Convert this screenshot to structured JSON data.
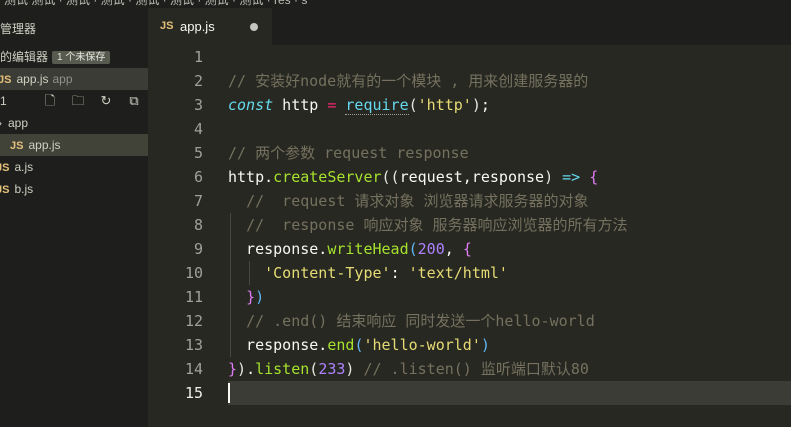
{
  "top_strip_text": "测试 测试 · 测试 · 测试 · 测试 · 测试 · 测试 · 测试 ·  res · s",
  "sidebar": {
    "explorer_title": "管理器",
    "open_editors_label": "的编辑器",
    "unsaved_badge": "1 个未保存",
    "open_file": {
      "tag": "JS",
      "name": "app.js",
      "folder": "app"
    },
    "folder_label": "1",
    "tree": [
      {
        "icon": "folder-chevron-icon",
        "name": "app",
        "tag": ""
      },
      {
        "icon": "js-file-icon",
        "name": "app.js",
        "tag": "JS"
      },
      {
        "icon": "js-file-icon",
        "name": "a.js",
        "tag": "JS"
      },
      {
        "icon": "js-file-icon",
        "name": "b.js",
        "tag": "JS"
      }
    ]
  },
  "tab": {
    "tag": "JS",
    "label": "app.js",
    "dirty": true
  },
  "editor": {
    "current_line": 15,
    "lines": [
      [],
      [
        {
          "t": "comment",
          "v": "// 安装好node就有的一个模块 , 用来创建服务器的"
        }
      ],
      [
        {
          "t": "keyword",
          "v": "const"
        },
        {
          "t": "plain",
          "v": " http "
        },
        {
          "t": "op",
          "v": "="
        },
        {
          "t": "plain",
          "v": " "
        },
        {
          "t": "builtin",
          "v": "require",
          "d": true
        },
        {
          "t": "paren",
          "v": "("
        },
        {
          "t": "string",
          "v": "'http'"
        },
        {
          "t": "paren",
          "v": ")"
        },
        {
          "t": "plain",
          "v": ";"
        }
      ],
      [],
      [
        {
          "t": "comment",
          "v": "// 两个参数 request response"
        }
      ],
      [
        {
          "t": "plain",
          "v": "http"
        },
        {
          "t": "plain",
          "v": "."
        },
        {
          "t": "func",
          "v": "createServer"
        },
        {
          "t": "paren",
          "v": "(("
        },
        {
          "t": "plain",
          "v": "request,response"
        },
        {
          "t": "paren",
          "v": ")"
        },
        {
          "t": "plain",
          "v": " "
        },
        {
          "t": "builtin",
          "v": "=>"
        },
        {
          "t": "plain",
          "v": " "
        },
        {
          "t": "brace2",
          "v": "{"
        }
      ],
      [
        {
          "t": "plain",
          "v": "  "
        },
        {
          "t": "comment",
          "v": "//  request 请求对象 浏览器请求服务器的对象"
        }
      ],
      [
        {
          "t": "plain",
          "v": "  "
        },
        {
          "t": "comment",
          "v": "//  response 响应对象 服务器响应浏览器的所有方法"
        }
      ],
      [
        {
          "t": "plain",
          "v": "  response."
        },
        {
          "t": "func",
          "v": "writeHead"
        },
        {
          "t": "brace3",
          "v": "("
        },
        {
          "t": "number",
          "v": "200"
        },
        {
          "t": "plain",
          "v": ", "
        },
        {
          "t": "brace2",
          "v": "{"
        }
      ],
      [
        {
          "t": "plain",
          "v": "    "
        },
        {
          "t": "string",
          "v": "'Content-Type'"
        },
        {
          "t": "plain",
          "v": ": "
        },
        {
          "t": "string",
          "v": "'text/html'"
        }
      ],
      [
        {
          "t": "plain",
          "v": "  "
        },
        {
          "t": "brace2",
          "v": "}"
        },
        {
          "t": "brace3",
          "v": ")"
        }
      ],
      [
        {
          "t": "plain",
          "v": "  "
        },
        {
          "t": "comment",
          "v": "// .end() 结束响应 同时发送一个hello-world"
        }
      ],
      [
        {
          "t": "plain",
          "v": "  response."
        },
        {
          "t": "func",
          "v": "end"
        },
        {
          "t": "brace3",
          "v": "("
        },
        {
          "t": "string",
          "v": "'hello-world'"
        },
        {
          "t": "brace3",
          "v": ")"
        }
      ],
      [
        {
          "t": "brace2",
          "v": "}"
        },
        {
          "t": "paren",
          "v": ")"
        },
        {
          "t": "plain",
          "v": "."
        },
        {
          "t": "func",
          "v": "listen"
        },
        {
          "t": "paren",
          "v": "("
        },
        {
          "t": "number",
          "v": "233"
        },
        {
          "t": "paren",
          "v": ")"
        },
        {
          "t": "plain",
          "v": " "
        },
        {
          "t": "comment",
          "v": "// .listen() 监听端口默认80"
        }
      ],
      []
    ]
  },
  "colors": {
    "editor_bg": "#272822",
    "sidebar_bg": "#1e1f1c",
    "comment": "#75715e",
    "keyword": "#66d9ef",
    "string": "#e6db74",
    "function": "#a6e22e",
    "number": "#ae81ff",
    "operator": "#f92672"
  }
}
